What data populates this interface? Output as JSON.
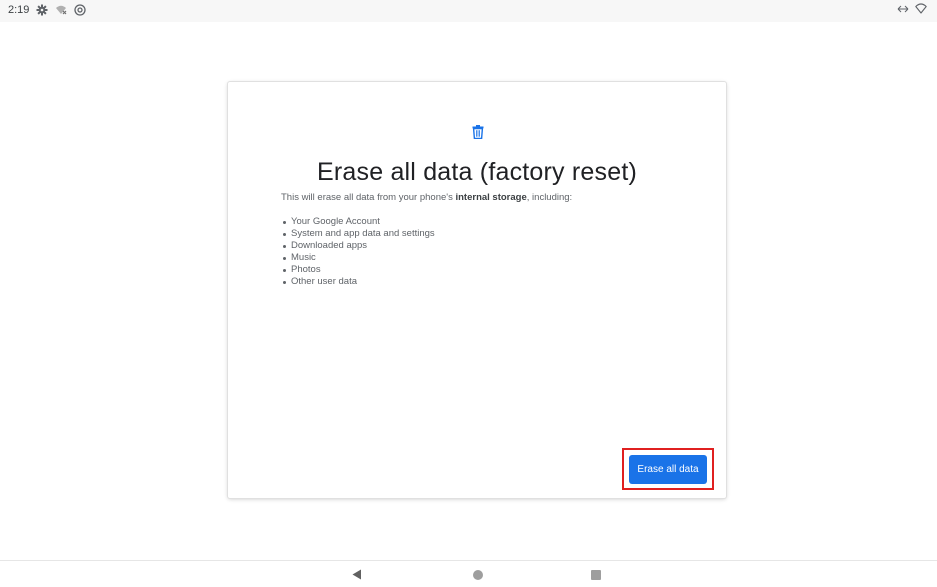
{
  "status_bar": {
    "time": "2:19",
    "icons_left": [
      "gear-icon",
      "wifi-off-icon",
      "at-sign-icon"
    ],
    "icons_right": [
      "data-transfer-icon",
      "wifi-icon"
    ]
  },
  "dialog": {
    "icon": "trash-icon",
    "title": "Erase all data (factory reset)",
    "intro_prefix": "This will erase all data from your phone's ",
    "intro_bold": "internal storage",
    "intro_suffix": ", including:",
    "items": [
      "Your Google Account",
      "System and app data and settings",
      "Downloaded apps",
      "Music",
      "Photos",
      "Other user data"
    ],
    "button_label": "Erase all data",
    "colors": {
      "accent": "#1a73e8",
      "highlight": "#e02020"
    }
  },
  "nav_bar": {
    "items": [
      "back-icon",
      "home-icon",
      "recents-icon"
    ]
  }
}
